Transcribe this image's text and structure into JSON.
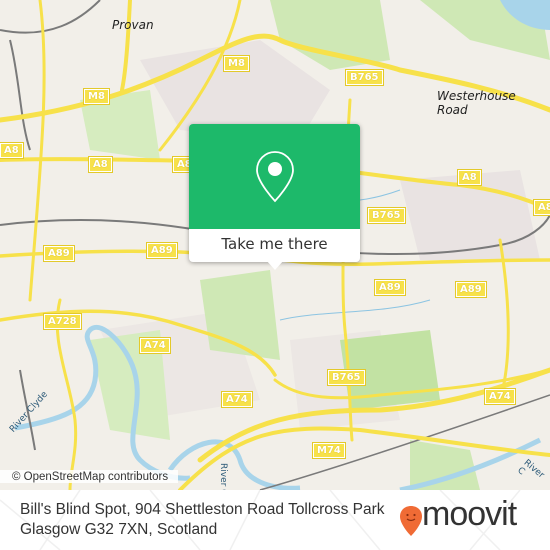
{
  "map": {
    "place_labels": [
      "Provan",
      "Westerhouse Road"
    ],
    "road_shields": [
      {
        "id": "m8-1",
        "label": "M8"
      },
      {
        "id": "m8-2",
        "label": "M8"
      },
      {
        "id": "b765-1",
        "label": "B765"
      },
      {
        "id": "a8-1",
        "label": "A8"
      },
      {
        "id": "a8-2",
        "label": "A8"
      },
      {
        "id": "a8-3",
        "label": "A8"
      },
      {
        "id": "a8-4",
        "label": "A8"
      },
      {
        "id": "a8-5",
        "label": "A8"
      },
      {
        "id": "b765-2",
        "label": "B765"
      },
      {
        "id": "a89-1",
        "label": "A89"
      },
      {
        "id": "a89-2",
        "label": "A89"
      },
      {
        "id": "a89-3",
        "label": "A89"
      },
      {
        "id": "a89-4",
        "label": "A89"
      },
      {
        "id": "a728",
        "label": "A728"
      },
      {
        "id": "a74-1",
        "label": "A74"
      },
      {
        "id": "a74-2",
        "label": "A74"
      },
      {
        "id": "b765-3",
        "label": "B765"
      },
      {
        "id": "a74-3",
        "label": "A74"
      },
      {
        "id": "m74",
        "label": "M74"
      }
    ],
    "river_labels": [
      "River Clyde",
      "River C",
      "River C"
    ],
    "attribution": "© OpenStreetMap contributors"
  },
  "popup": {
    "icon": "map-pin-icon",
    "button_label": "Take me there",
    "color": "#1db96a"
  },
  "footer": {
    "address_line1": "Bill's Blind Spot, 904 Shettleston Road Tollcross Park",
    "address_line2": "Glasgow G32 7XN, Scotland",
    "brand": "moovit",
    "brand_color": "#f06b35"
  }
}
